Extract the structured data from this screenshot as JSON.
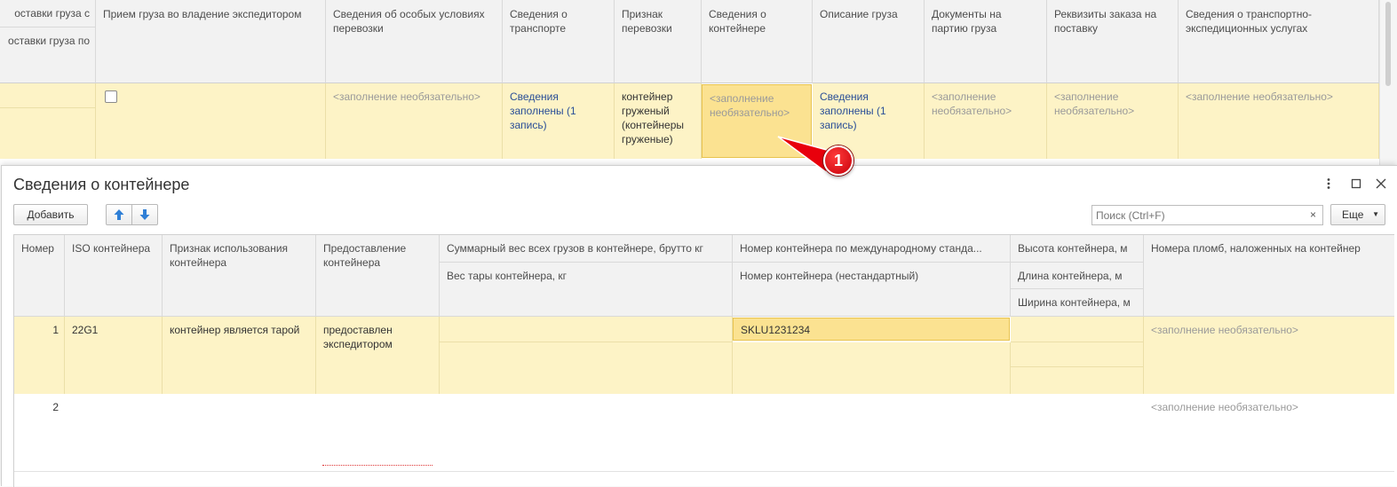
{
  "background_table": {
    "left_header": {
      "line1": "оставки груза с",
      "line2": "оставки груза по"
    },
    "headers": [
      "Прием груза во владение экспедитором",
      "Сведения об особых условиях перевозки",
      "Сведения о транспорте",
      "Признак перевозки",
      "Сведения о контейнере",
      "Описание груза",
      "Документы на партию груза",
      "Реквизиты заказа на поставку",
      "Сведения о транспортно-экспедиционных услугах"
    ],
    "row": {
      "special_conditions": "<заполнение необязательно>",
      "transport_info": "Сведения заполнены (1 запись)",
      "carriage_sign": "контейнер груженый (контейнеры груженые)",
      "container_info": "<заполнение необязательно>",
      "cargo_description": "Сведения заполнены (1 запись)",
      "cargo_documents": "<заполнение необязательно>",
      "order_details": "<заполнение необязательно>",
      "services_info": "<заполнение необязательно>"
    }
  },
  "callout": {
    "number": "1",
    "color": "#e8000c"
  },
  "dialog": {
    "title": "Сведения о контейнере",
    "add_label": "Добавить",
    "search_placeholder": "Поиск (Ctrl+F)",
    "search_clear": "×",
    "more_label": "Еще",
    "columns": {
      "number": "Номер",
      "iso": "ISO контейнера",
      "usage": "Признак использования контейнера",
      "provision": "Предоставление контейнера",
      "gross_weight": "Суммарный вес всех грузов в контейнере, брутто кг",
      "tare_weight": "Вес тары контейнера, кг",
      "intl_number": "Номер контейнера по международному станда...",
      "nonstd_number": "Номер контейнера (нестандартный)",
      "height": "Высота контейнера, м",
      "length": "Длина контейнера, м",
      "width": "Ширина контейнера, м",
      "seals": "Номера пломб, наложенных на контейнер"
    },
    "rows": [
      {
        "number": "1",
        "iso": "22G1",
        "usage": "контейнер является тарой",
        "provision": "предоставлен экспедитором",
        "intl_number": "SKLU1231234",
        "seals": "<заполнение необязательно>"
      },
      {
        "number": "2",
        "seals": "<заполнение необязательно>"
      }
    ]
  },
  "colors": {
    "row_highlight": "#fdf3c6",
    "focused_cell": "#fbe291",
    "link": "#2a4f97"
  }
}
